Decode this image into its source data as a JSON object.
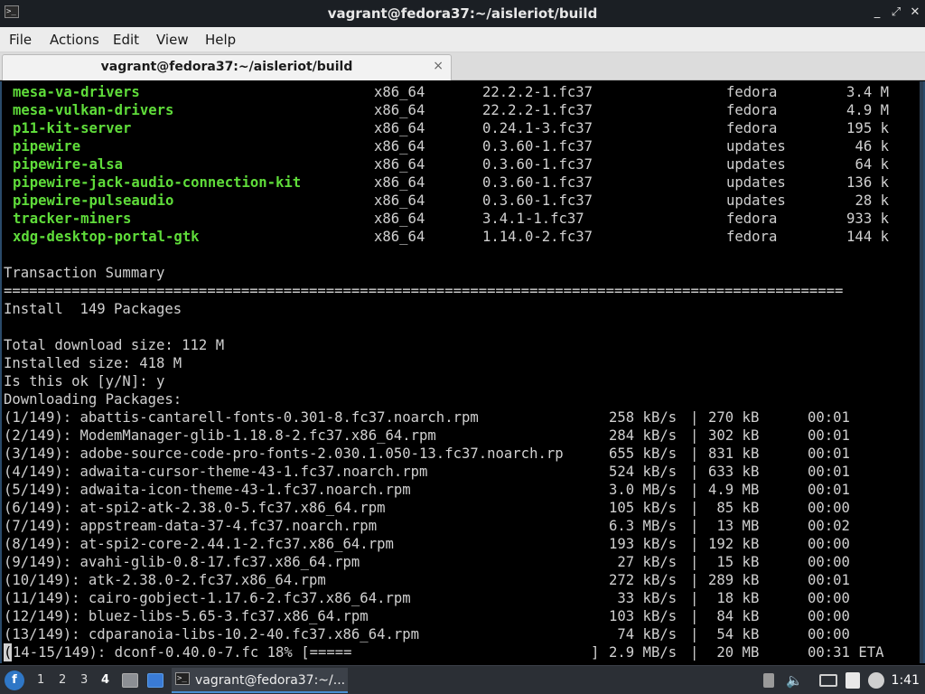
{
  "window": {
    "title": "vagrant@fedora37:~/aisleriot/build",
    "app_icon": ">_",
    "minimize_glyph": "_",
    "maximize_glyph": "⤢",
    "close_glyph": "✕"
  },
  "menu": [
    "File",
    "Actions",
    "Edit",
    "View",
    "Help"
  ],
  "tab": {
    "label": "vagrant@fedora37:~/aisleriot/build",
    "close_glyph": "×"
  },
  "packages": [
    {
      "name": "mesa-va-drivers",
      "arch": "x86_64",
      "version": "22.2.2-1.fc37",
      "repo": "fedora",
      "size": "3.4 M"
    },
    {
      "name": "mesa-vulkan-drivers",
      "arch": "x86_64",
      "version": "22.2.2-1.fc37",
      "repo": "fedora",
      "size": "4.9 M"
    },
    {
      "name": "p11-kit-server",
      "arch": "x86_64",
      "version": "0.24.1-3.fc37",
      "repo": "fedora",
      "size": "195 k"
    },
    {
      "name": "pipewire",
      "arch": "x86_64",
      "version": "0.3.60-1.fc37",
      "repo": "updates",
      "size": "46 k"
    },
    {
      "name": "pipewire-alsa",
      "arch": "x86_64",
      "version": "0.3.60-1.fc37",
      "repo": "updates",
      "size": "64 k"
    },
    {
      "name": "pipewire-jack-audio-connection-kit",
      "arch": "x86_64",
      "version": "0.3.60-1.fc37",
      "repo": "updates",
      "size": "136 k"
    },
    {
      "name": "pipewire-pulseaudio",
      "arch": "x86_64",
      "version": "0.3.60-1.fc37",
      "repo": "updates",
      "size": "28 k"
    },
    {
      "name": "tracker-miners",
      "arch": "x86_64",
      "version": "3.4.1-1.fc37",
      "repo": "fedora",
      "size": "933 k"
    },
    {
      "name": "xdg-desktop-portal-gtk",
      "arch": "x86_64",
      "version": "1.14.0-2.fc37",
      "repo": "fedora",
      "size": "144 k"
    }
  ],
  "summary": {
    "header": "Transaction Summary",
    "rule": "===================================================================================================",
    "install": "Install  149 Packages",
    "download_size": "Total download size: 112 M",
    "installed_size": "Installed size: 418 M",
    "prompt": "Is this ok [y/N]: y",
    "downloading": "Downloading Packages:"
  },
  "downloads": [
    {
      "file": "(1/149): abattis-cantarell-fonts-0.301-8.fc37.noarch.rpm",
      "speed": "258 kB/s",
      "size": "270 kB",
      "time": "00:01"
    },
    {
      "file": "(2/149): ModemManager-glib-1.18.8-2.fc37.x86_64.rpm",
      "speed": "284 kB/s",
      "size": "302 kB",
      "time": "00:01"
    },
    {
      "file": "(3/149): adobe-source-code-pro-fonts-2.030.1.050-13.fc37.noarch.rp",
      "speed": "655 kB/s",
      "size": "831 kB",
      "time": "00:01"
    },
    {
      "file": "(4/149): adwaita-cursor-theme-43-1.fc37.noarch.rpm",
      "speed": "524 kB/s",
      "size": "633 kB",
      "time": "00:01"
    },
    {
      "file": "(5/149): adwaita-icon-theme-43-1.fc37.noarch.rpm",
      "speed": "3.0 MB/s",
      "size": "4.9 MB",
      "time": "00:01"
    },
    {
      "file": "(6/149): at-spi2-atk-2.38.0-5.fc37.x86_64.rpm",
      "speed": "105 kB/s",
      "size": " 85 kB",
      "time": "00:00"
    },
    {
      "file": "(7/149): appstream-data-37-4.fc37.noarch.rpm",
      "speed": "6.3 MB/s",
      "size": " 13 MB",
      "time": "00:02"
    },
    {
      "file": "(8/149): at-spi2-core-2.44.1-2.fc37.x86_64.rpm",
      "speed": "193 kB/s",
      "size": "192 kB",
      "time": "00:00"
    },
    {
      "file": "(9/149): avahi-glib-0.8-17.fc37.x86_64.rpm",
      "speed": " 27 kB/s",
      "size": " 15 kB",
      "time": "00:00"
    },
    {
      "file": "(10/149): atk-2.38.0-2.fc37.x86_64.rpm",
      "speed": "272 kB/s",
      "size": "289 kB",
      "time": "00:01"
    },
    {
      "file": "(11/149): cairo-gobject-1.17.6-2.fc37.x86_64.rpm",
      "speed": " 33 kB/s",
      "size": " 18 kB",
      "time": "00:00"
    },
    {
      "file": "(12/149): bluez-libs-5.65-3.fc37.x86_64.rpm",
      "speed": "103 kB/s",
      "size": " 84 kB",
      "time": "00:00"
    },
    {
      "file": "(13/149): cdparanoia-libs-10.2-40.fc37.x86_64.rpm",
      "speed": " 74 kB/s",
      "size": " 54 kB",
      "time": "00:00"
    }
  ],
  "progress": {
    "cursor_char": "(",
    "label": "14-15/149): dconf-0.40.0-7.fc 18% [=====",
    "bracket_end": "]",
    "speed": "2.9 MB/s",
    "size": " 20 MB",
    "eta": "00:31 ETA",
    "sep": "|"
  },
  "panel": {
    "start_glyph": "f",
    "workspaces": [
      "1",
      "2",
      "3",
      "4"
    ],
    "active_workspace": "4",
    "task_icon": ">_",
    "task_label": "vagrant@fedora37:~/...",
    "tray_icons": [
      "updates-icon",
      "volume-icon",
      "network-icon",
      "clipboard-icon",
      "notification-icon"
    ],
    "clock": "1:41"
  }
}
